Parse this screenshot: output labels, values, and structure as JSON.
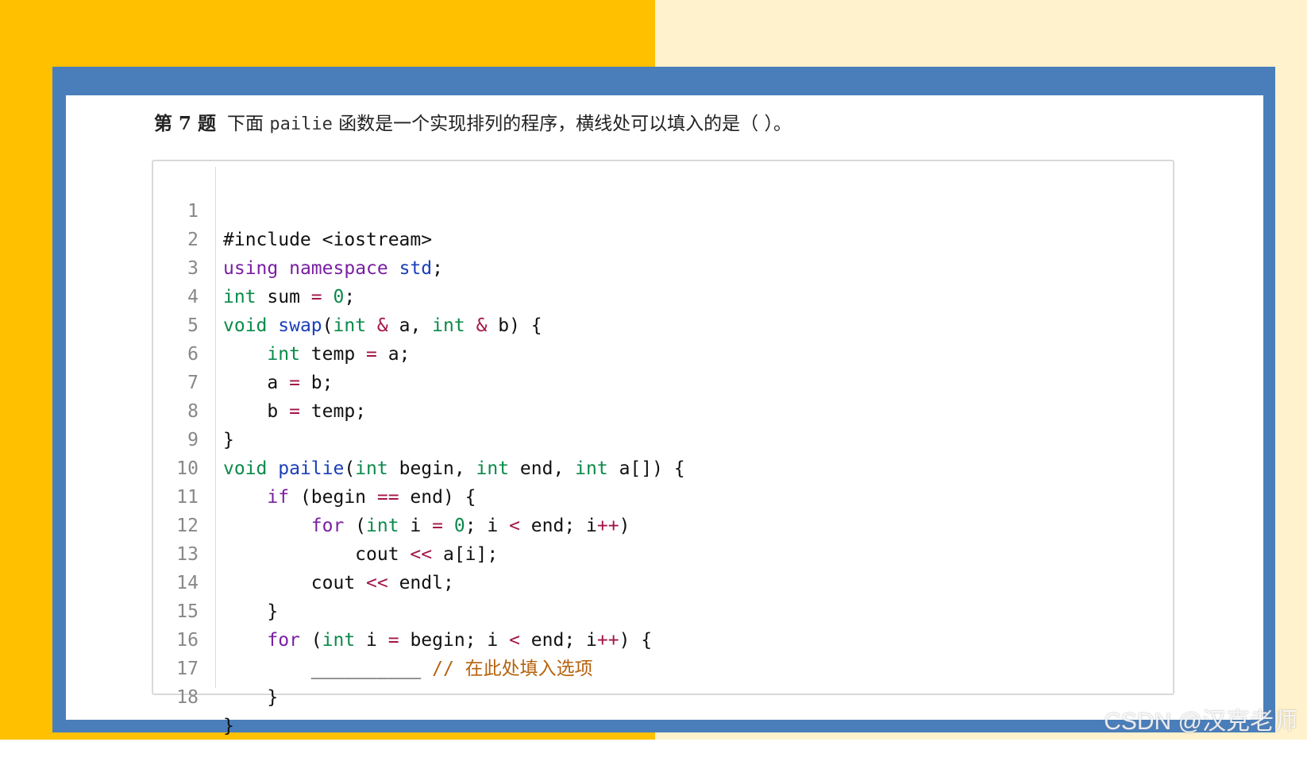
{
  "question": {
    "number": "第 7 题",
    "text_before": "下面 ",
    "function_name": "pailie",
    "text_after": " 函数是一个实现排列的程序，横线处可以填入的是（ ）。"
  },
  "code": {
    "line_numbers": [
      "1",
      "2",
      "3",
      "4",
      "5",
      "6",
      "7",
      "8",
      "9",
      "10",
      "11",
      "12",
      "13",
      "14",
      "15",
      "16",
      "17",
      "18"
    ],
    "l1": "#include <iostream>",
    "l2": {
      "kw1": "using",
      "kw2": "namespace",
      "ns": "std",
      "rest": ";"
    },
    "l3": {
      "ty": "int",
      "a": " sum ",
      "op": "=",
      "b": " ",
      "num": "0",
      "c": ";"
    },
    "l4": {
      "kw": "void",
      "fn": "swap",
      "p1": "(",
      "ty1": "int",
      "op1": "&",
      "v1": " a, ",
      "ty2": "int",
      "op2": "&",
      "v2": " b) {"
    },
    "l5": {
      "ty": "int",
      "a": " temp ",
      "op": "=",
      "b": " a;"
    },
    "l6": {
      "a": "a ",
      "op": "=",
      "b": " b;"
    },
    "l7": {
      "a": "b ",
      "op": "=",
      "b": " temp;"
    },
    "l8": "}",
    "l9": {
      "kw": "void",
      "fn": "pailie",
      "p1": "(",
      "ty1": "int",
      "v1": " begin, ",
      "ty2": "int",
      "v2": " end, ",
      "ty3": "int",
      "v3": " a[]) {"
    },
    "l10": {
      "kw": "if",
      "a": " (begin ",
      "op": "==",
      "b": " end) {"
    },
    "l11": {
      "kw": "for",
      "a": " (",
      "ty": "int",
      "b": " i ",
      "op1": "=",
      "c": " ",
      "num": "0",
      "d": "; i ",
      "op2": "<",
      "e": " end; i",
      "op3": "++",
      "f": ")"
    },
    "l12": {
      "a": "cout ",
      "op": "<<",
      "b": " a[i];"
    },
    "l13": {
      "a": "cout ",
      "op": "<<",
      "b": " endl;"
    },
    "l14": "}",
    "l15": {
      "kw": "for",
      "a": " (",
      "ty": "int",
      "b": " i ",
      "op1": "=",
      "c": " begin; i ",
      "op2": "<",
      "d": " end; i",
      "op3": "++",
      "e": ") {"
    },
    "l16": {
      "blank": "__________",
      "comment": "// ",
      "comment_cn": "在此处填入选项"
    },
    "l17": "}",
    "l18": "}"
  },
  "watermark": "CSDN @汉克老师",
  "colors": {
    "left_bg": "#FFC000",
    "right_bg": "#FFF2CC",
    "frame": "#4A7EBB"
  }
}
